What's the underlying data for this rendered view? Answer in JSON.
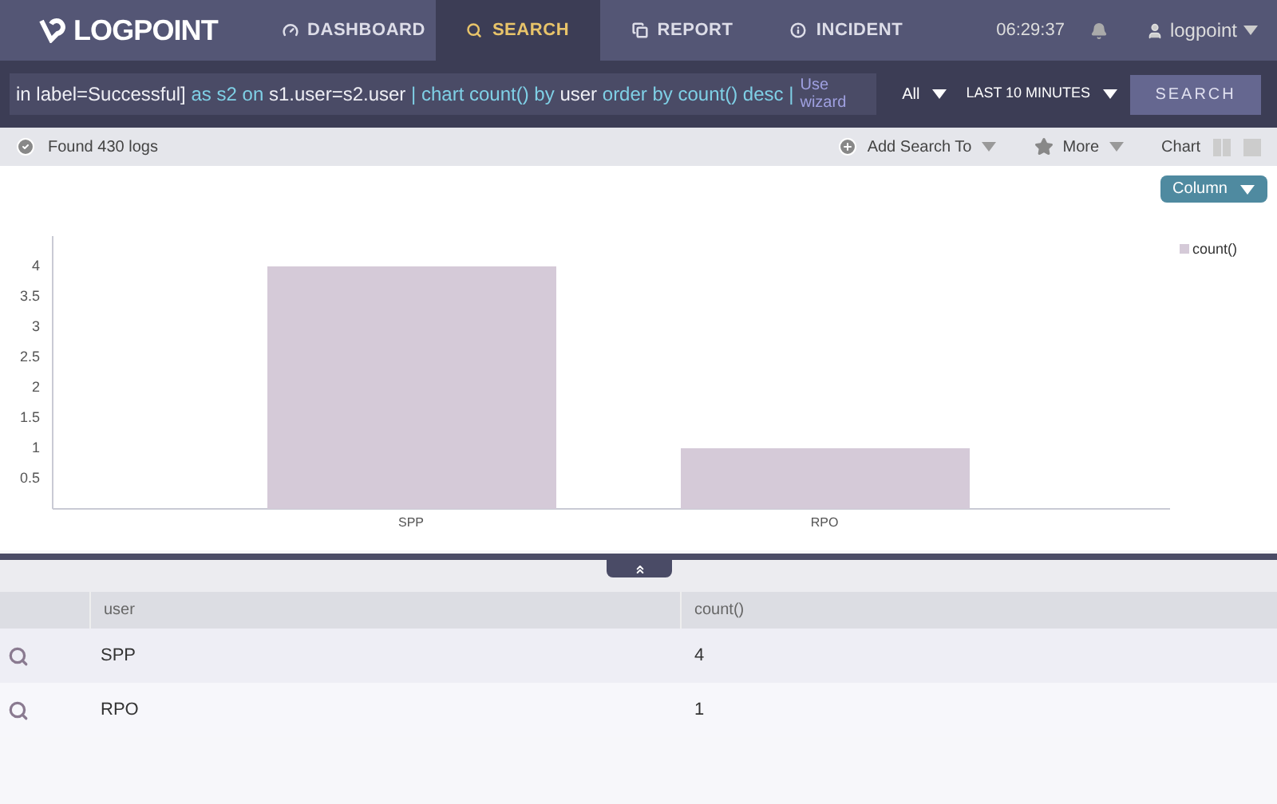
{
  "header": {
    "logo": "LOGPOINT",
    "nav": [
      {
        "label": "DASHBOARD",
        "kind": "dashboard",
        "selected": false
      },
      {
        "label": "SEARCH",
        "kind": "search",
        "selected": true
      },
      {
        "label": "REPORT",
        "kind": "report",
        "selected": false
      },
      {
        "label": "INCIDENT",
        "kind": "incident",
        "selected": false
      }
    ],
    "time": "06:29:37",
    "user": "logpoint"
  },
  "search_bar": {
    "query": [
      {
        "kind": "plain",
        "text": "in label=Successful]"
      },
      {
        "kind": "keyword",
        "text": "as s2 on"
      },
      {
        "kind": "plain",
        "text": "s1.user=s2.user"
      },
      {
        "kind": "keyword",
        "text": "| chart count() by"
      },
      {
        "kind": "plain",
        "text": "user"
      },
      {
        "kind": "keyword",
        "text": "order by count() desc |"
      }
    ],
    "wizard_link": "Use wizard",
    "repo": "All",
    "range": "LAST 10 MINUTES",
    "button": "SEARCH"
  },
  "toolbar": {
    "status": "Found 430 logs",
    "add_search": "Add Search To",
    "more": "More",
    "view": "Chart"
  },
  "chart_type": "Column",
  "chart_data": {
    "type": "bar",
    "categories": [
      "SPP",
      "RPO"
    ],
    "series": [
      {
        "name": "count()",
        "color": "#d5cad8",
        "values": [
          4,
          1
        ]
      }
    ],
    "ylim": [
      0,
      4.5
    ],
    "yticks": [
      0.5,
      1,
      1.5,
      2,
      2.5,
      3,
      3.5,
      4
    ]
  },
  "table": {
    "columns": [
      "user",
      "count()"
    ],
    "rows": [
      [
        "SPP",
        "4"
      ],
      [
        "RPO",
        "1"
      ]
    ]
  }
}
